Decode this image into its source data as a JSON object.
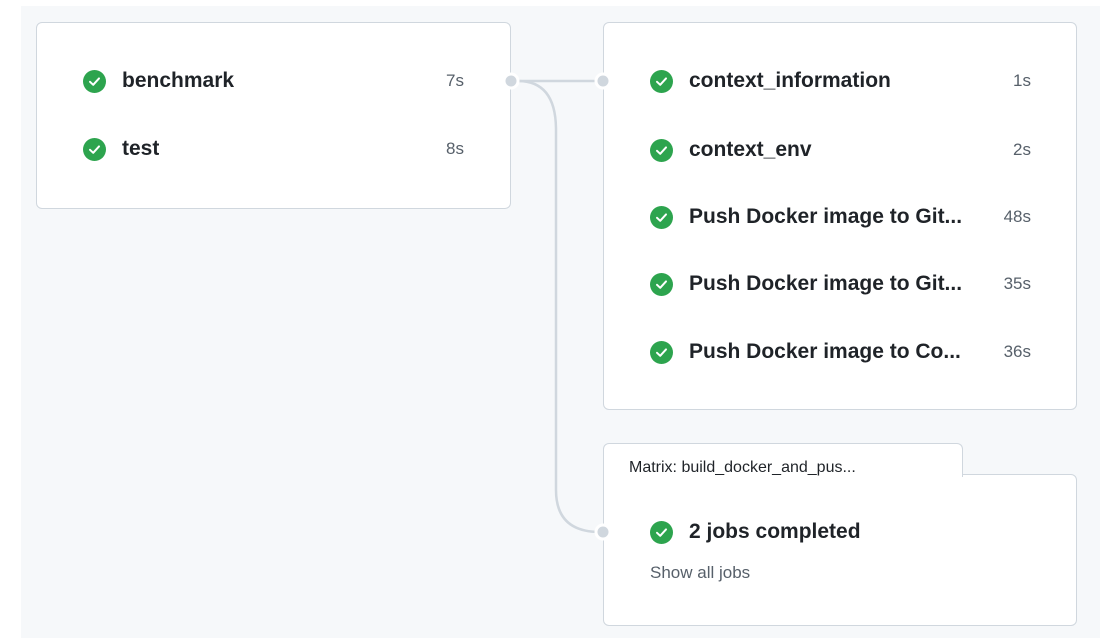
{
  "stage1": {
    "jobs": [
      {
        "name": "benchmark",
        "duration": "7s",
        "status_icon": "check-circle-icon"
      },
      {
        "name": "test",
        "duration": "8s",
        "status_icon": "check-circle-icon"
      }
    ]
  },
  "stage2": {
    "jobs": [
      {
        "name": "context_information",
        "duration": "1s",
        "status_icon": "check-circle-icon"
      },
      {
        "name": "context_env",
        "duration": "2s",
        "status_icon": "check-circle-icon"
      },
      {
        "name": "Push Docker image to Git...",
        "duration": "48s",
        "status_icon": "check-circle-icon"
      },
      {
        "name": "Push Docker image to Git...",
        "duration": "35s",
        "status_icon": "check-circle-icon"
      },
      {
        "name": "Push Docker image to Co...",
        "duration": "36s",
        "status_icon": "check-circle-icon"
      }
    ]
  },
  "matrix": {
    "title": "Matrix: build_docker_and_pus...",
    "summary": "2 jobs completed",
    "show_all_label": "Show all jobs"
  },
  "colors": {
    "success": "#2da44e",
    "border": "#d0d7de",
    "canvas": "#f6f8fa",
    "muted_text": "#57606a",
    "connector": "#d0d7de"
  }
}
